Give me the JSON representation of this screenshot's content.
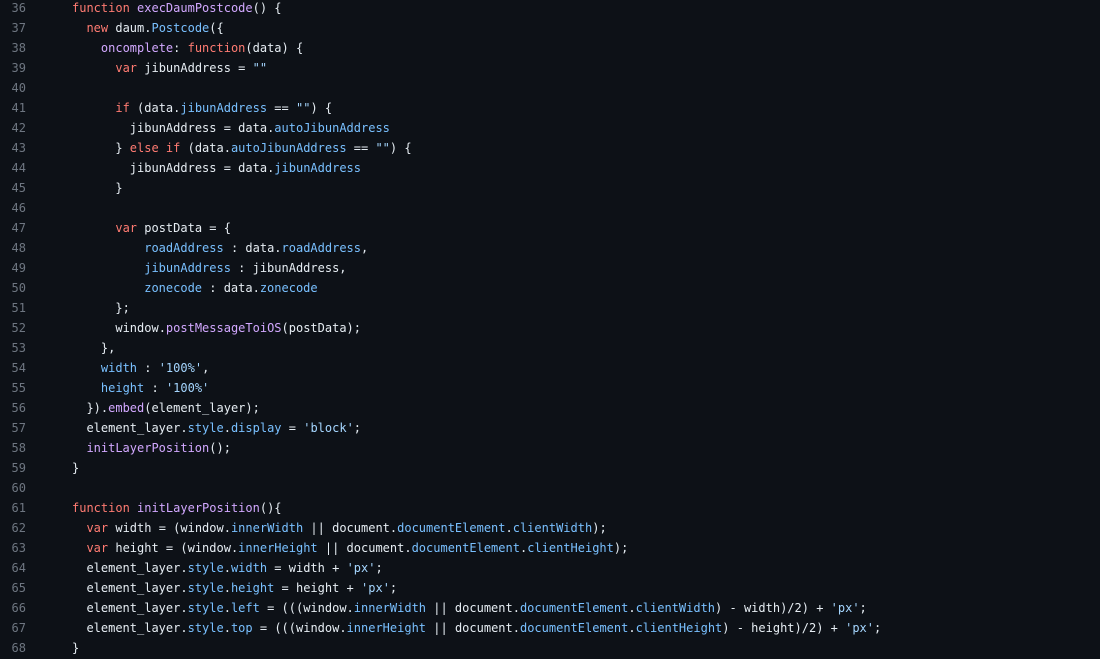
{
  "colors": {
    "background": "#0d1117",
    "text": "#e6edf3",
    "line_number": "#6e7681",
    "keyword": "#ff7b72",
    "function": "#d2a8ff",
    "property": "#79c0ff",
    "string": "#a5d6ff"
  },
  "lines": [
    {
      "n": "36",
      "indent": 0,
      "tokens": [
        [
          "k",
          "function"
        ],
        [
          "t",
          " "
        ],
        [
          "f",
          "execDaumPostcode"
        ],
        [
          "t",
          "() {"
        ]
      ]
    },
    {
      "n": "37",
      "indent": 1,
      "tokens": [
        [
          "k",
          "new"
        ],
        [
          "t",
          " daum."
        ],
        [
          "p",
          "Postcode"
        ],
        [
          "t",
          "({"
        ]
      ]
    },
    {
      "n": "38",
      "indent": 2,
      "tokens": [
        [
          "f",
          "oncomplete"
        ],
        [
          "t",
          ": "
        ],
        [
          "k",
          "function"
        ],
        [
          "t",
          "(data) {"
        ]
      ]
    },
    {
      "n": "39",
      "indent": 3,
      "tokens": [
        [
          "k",
          "var"
        ],
        [
          "t",
          " jibunAddress = "
        ],
        [
          "s",
          "\"\""
        ]
      ]
    },
    {
      "n": "40",
      "indent": 0,
      "tokens": []
    },
    {
      "n": "41",
      "indent": 3,
      "tokens": [
        [
          "k",
          "if"
        ],
        [
          "t",
          " (data."
        ],
        [
          "p",
          "jibunAddress"
        ],
        [
          "t",
          " == "
        ],
        [
          "s",
          "\"\""
        ],
        [
          "t",
          ") {"
        ]
      ]
    },
    {
      "n": "42",
      "indent": 4,
      "tokens": [
        [
          "t",
          "jibunAddress = data."
        ],
        [
          "p",
          "autoJibunAddress"
        ]
      ]
    },
    {
      "n": "43",
      "indent": 3,
      "tokens": [
        [
          "t",
          "} "
        ],
        [
          "k",
          "else if"
        ],
        [
          "t",
          " (data."
        ],
        [
          "p",
          "autoJibunAddress"
        ],
        [
          "t",
          " == "
        ],
        [
          "s",
          "\"\""
        ],
        [
          "t",
          ") {"
        ]
      ]
    },
    {
      "n": "44",
      "indent": 4,
      "tokens": [
        [
          "t",
          "jibunAddress = data."
        ],
        [
          "p",
          "jibunAddress"
        ]
      ]
    },
    {
      "n": "45",
      "indent": 3,
      "tokens": [
        [
          "t",
          "}"
        ]
      ]
    },
    {
      "n": "46",
      "indent": 0,
      "tokens": []
    },
    {
      "n": "47",
      "indent": 3,
      "tokens": [
        [
          "k",
          "var"
        ],
        [
          "t",
          " postData = {"
        ]
      ]
    },
    {
      "n": "48",
      "indent": 5,
      "tokens": [
        [
          "p",
          "roadAddress"
        ],
        [
          "t",
          " : data."
        ],
        [
          "p",
          "roadAddress"
        ],
        [
          "t",
          ","
        ]
      ]
    },
    {
      "n": "49",
      "indent": 5,
      "tokens": [
        [
          "p",
          "jibunAddress"
        ],
        [
          "t",
          " : jibunAddress,"
        ]
      ]
    },
    {
      "n": "50",
      "indent": 5,
      "tokens": [
        [
          "p",
          "zonecode"
        ],
        [
          "t",
          " : data."
        ],
        [
          "p",
          "zonecode"
        ]
      ]
    },
    {
      "n": "51",
      "indent": 3,
      "tokens": [
        [
          "t",
          "};"
        ]
      ]
    },
    {
      "n": "52",
      "indent": 3,
      "tokens": [
        [
          "t",
          "window."
        ],
        [
          "f",
          "postMessageToiOS"
        ],
        [
          "t",
          "(postData);"
        ]
      ]
    },
    {
      "n": "53",
      "indent": 2,
      "tokens": [
        [
          "t",
          "},"
        ]
      ]
    },
    {
      "n": "54",
      "indent": 2,
      "tokens": [
        [
          "p",
          "width"
        ],
        [
          "t",
          " : "
        ],
        [
          "s",
          "'100%'"
        ],
        [
          "t",
          ","
        ]
      ]
    },
    {
      "n": "55",
      "indent": 2,
      "tokens": [
        [
          "p",
          "height"
        ],
        [
          "t",
          " : "
        ],
        [
          "s",
          "'100%'"
        ]
      ]
    },
    {
      "n": "56",
      "indent": 1,
      "tokens": [
        [
          "t",
          "})."
        ],
        [
          "f",
          "embed"
        ],
        [
          "t",
          "(element_layer);"
        ]
      ]
    },
    {
      "n": "57",
      "indent": 1,
      "tokens": [
        [
          "t",
          "element_layer."
        ],
        [
          "p",
          "style"
        ],
        [
          "t",
          "."
        ],
        [
          "p",
          "display"
        ],
        [
          "t",
          " = "
        ],
        [
          "s",
          "'block'"
        ],
        [
          "t",
          ";"
        ]
      ]
    },
    {
      "n": "58",
      "indent": 1,
      "tokens": [
        [
          "f",
          "initLayerPosition"
        ],
        [
          "t",
          "();"
        ]
      ]
    },
    {
      "n": "59",
      "indent": 0,
      "tokens": [
        [
          "t",
          "}"
        ]
      ]
    },
    {
      "n": "60",
      "indent": 0,
      "tokens": []
    },
    {
      "n": "61",
      "indent": 0,
      "tokens": [
        [
          "k",
          "function"
        ],
        [
          "t",
          " "
        ],
        [
          "f",
          "initLayerPosition"
        ],
        [
          "t",
          "(){"
        ]
      ]
    },
    {
      "n": "62",
      "indent": 1,
      "tokens": [
        [
          "k",
          "var"
        ],
        [
          "t",
          " width = (window."
        ],
        [
          "p",
          "innerWidth"
        ],
        [
          "t",
          " || document."
        ],
        [
          "p",
          "documentElement"
        ],
        [
          "t",
          "."
        ],
        [
          "p",
          "clientWidth"
        ],
        [
          "t",
          ");"
        ]
      ]
    },
    {
      "n": "63",
      "indent": 1,
      "tokens": [
        [
          "k",
          "var"
        ],
        [
          "t",
          " height = (window."
        ],
        [
          "p",
          "innerHeight"
        ],
        [
          "t",
          " || document."
        ],
        [
          "p",
          "documentElement"
        ],
        [
          "t",
          "."
        ],
        [
          "p",
          "clientHeight"
        ],
        [
          "t",
          ");"
        ]
      ]
    },
    {
      "n": "64",
      "indent": 1,
      "tokens": [
        [
          "t",
          "element_layer."
        ],
        [
          "p",
          "style"
        ],
        [
          "t",
          "."
        ],
        [
          "p",
          "width"
        ],
        [
          "t",
          " = width + "
        ],
        [
          "s",
          "'px'"
        ],
        [
          "t",
          ";"
        ]
      ]
    },
    {
      "n": "65",
      "indent": 1,
      "tokens": [
        [
          "t",
          "element_layer."
        ],
        [
          "p",
          "style"
        ],
        [
          "t",
          "."
        ],
        [
          "p",
          "height"
        ],
        [
          "t",
          " = height + "
        ],
        [
          "s",
          "'px'"
        ],
        [
          "t",
          ";"
        ]
      ]
    },
    {
      "n": "66",
      "indent": 1,
      "tokens": [
        [
          "t",
          "element_layer."
        ],
        [
          "p",
          "style"
        ],
        [
          "t",
          "."
        ],
        [
          "p",
          "left"
        ],
        [
          "t",
          " = (((window."
        ],
        [
          "p",
          "innerWidth"
        ],
        [
          "t",
          " || document."
        ],
        [
          "p",
          "documentElement"
        ],
        [
          "t",
          "."
        ],
        [
          "p",
          "clientWidth"
        ],
        [
          "t",
          ") - width)/2) + "
        ],
        [
          "s",
          "'px'"
        ],
        [
          "t",
          ";"
        ]
      ]
    },
    {
      "n": "67",
      "indent": 1,
      "tokens": [
        [
          "t",
          "element_layer."
        ],
        [
          "p",
          "style"
        ],
        [
          "t",
          "."
        ],
        [
          "p",
          "top"
        ],
        [
          "t",
          " = (((window."
        ],
        [
          "p",
          "innerHeight"
        ],
        [
          "t",
          " || document."
        ],
        [
          "p",
          "documentElement"
        ],
        [
          "t",
          "."
        ],
        [
          "p",
          "clientHeight"
        ],
        [
          "t",
          ") - height)/2) + "
        ],
        [
          "s",
          "'px'"
        ],
        [
          "t",
          ";"
        ]
      ]
    },
    {
      "n": "68",
      "indent": 0,
      "tokens": [
        [
          "t",
          "}"
        ]
      ]
    }
  ]
}
